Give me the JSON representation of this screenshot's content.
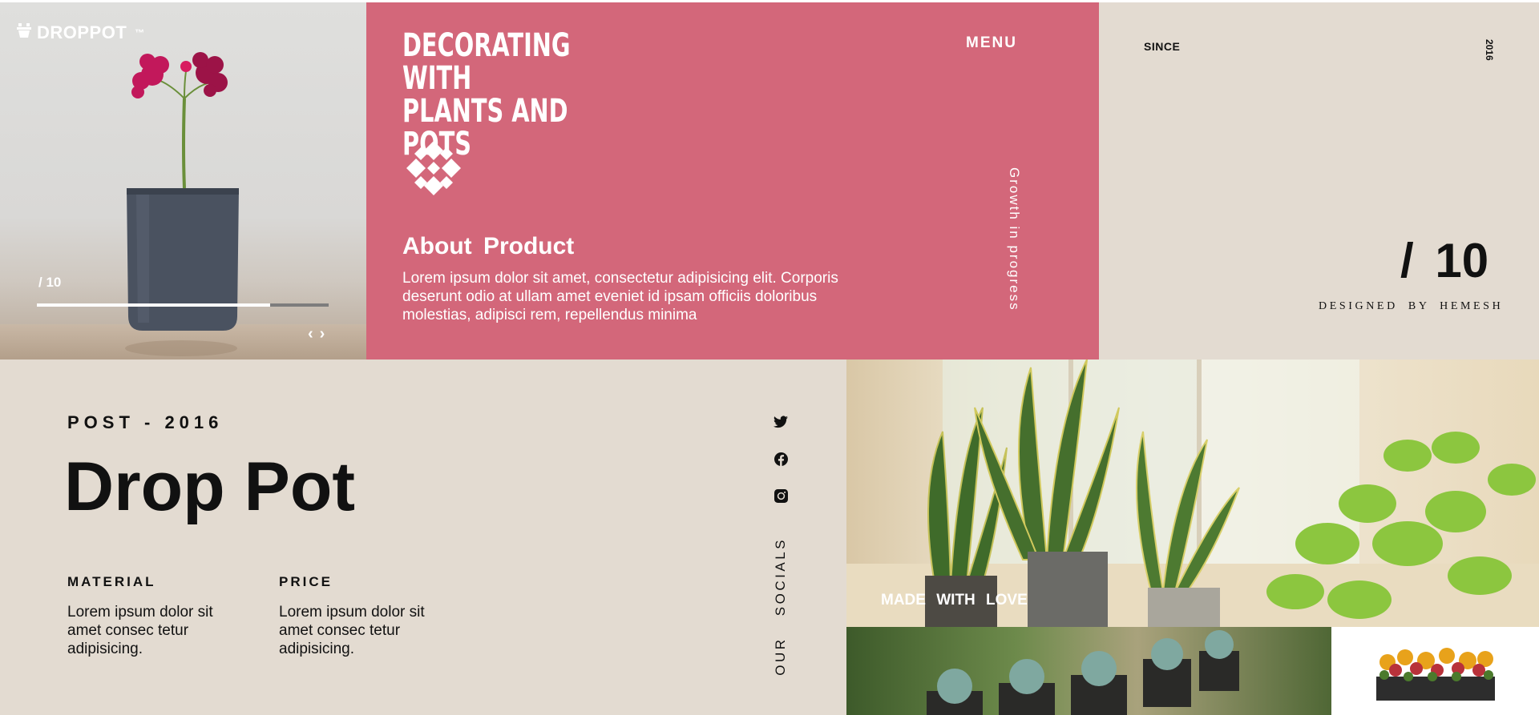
{
  "brand": {
    "name": "DROPPOT",
    "tm": "™"
  },
  "hero": {
    "counter": "/ 10",
    "progress": 0.8
  },
  "pink_panel": {
    "title_line1": "DECORATING WITH",
    "title_line2": "PLANTS AND POTS",
    "menu_label": "MENU",
    "growth_label": "Growth in progress",
    "about_title": "About Product",
    "about_text": "Lorem ipsum dolor sit amet, consectetur adipisicing elit. Corporis deserunt odio at ullam amet eveniet id ipsam officiis doloribus molestias, adipisci rem, repellendus minima"
  },
  "right_panel": {
    "since_label": "SINCE",
    "year": "2016",
    "big_counter": "/ 10",
    "designed_by": "DESIGNED BY HEMESH"
  },
  "product": {
    "post_label": "POST - 2016",
    "name": "Drop Pot",
    "material_heading": "MATERIAL",
    "material_text": "Lorem ipsum dolor sit amet consec tetur adipisicing.",
    "price_heading": "PRICE",
    "price_text": "Lorem ipsum dolor sit amet consec tetur adipisicing."
  },
  "socials": {
    "label": "OUR SOCIALS",
    "icons": [
      "twitter-icon",
      "facebook-icon",
      "instagram-icon"
    ]
  },
  "gallery": {
    "made_with_love": "MADE WITH LOVE"
  },
  "colors": {
    "pink": "#d3677a",
    "beige": "#e3dbd1",
    "dark": "#111111",
    "white": "#ffffff"
  }
}
